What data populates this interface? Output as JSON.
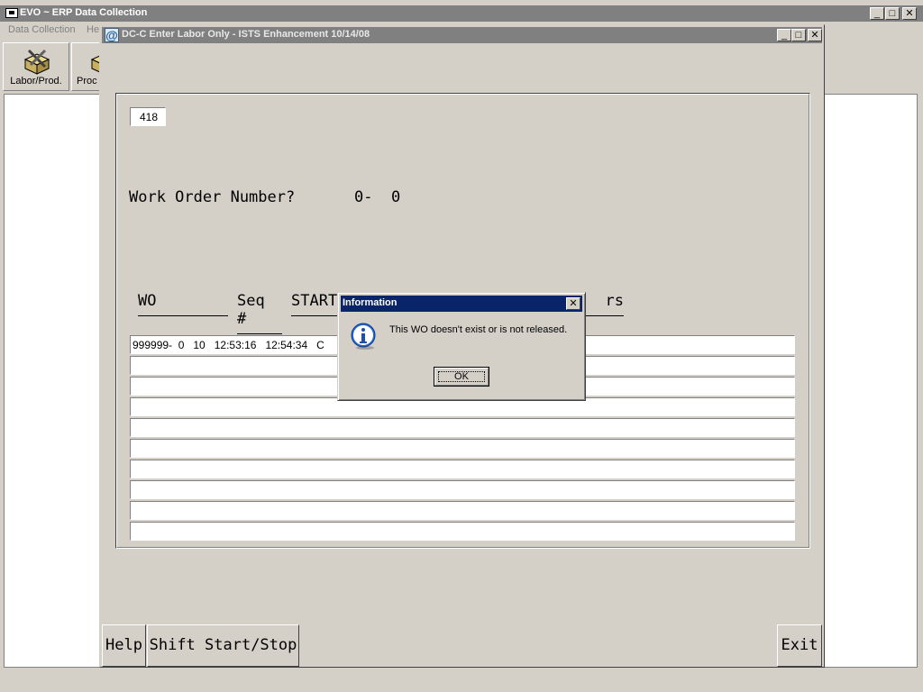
{
  "app": {
    "title": "EVO ~ ERP Data Collection",
    "window_controls": {
      "minimize": "_",
      "maximize": "□",
      "close": "✕"
    },
    "menu": [
      "Data Collection",
      "He"
    ],
    "toolbar": [
      {
        "label": "Labor/Prod.",
        "icon": "labor-production-icon"
      },
      {
        "label": "Proc",
        "icon": "production-icon"
      }
    ]
  },
  "child_window": {
    "title": "DC-C  Enter Labor Only - ISTS Enhancement 10/14/08",
    "icon": "@",
    "employee_field": "418",
    "prompt_label": "Work Order Number?",
    "prompt_value": "0-  0",
    "table_headers": [
      "WO",
      "Seq #",
      "START",
      "rs"
    ],
    "rows": [
      "999999-  0   10   12:53:16   12:54:34   C",
      "",
      "",
      "",
      "",
      "",
      "",
      "",
      "",
      ""
    ],
    "buttons": {
      "help": "Help",
      "shift": "Shift Start/Stop",
      "exit": "Exit"
    }
  },
  "dialog": {
    "title": "Information",
    "message": "This WO doesn't exist or is not released.",
    "ok_label": "OK",
    "icon": "information-icon",
    "close": "✕"
  },
  "colors": {
    "dialog_title_bg": "#0a246a",
    "inactive_title_bg": "#808080",
    "face": "#d4d0c8"
  }
}
